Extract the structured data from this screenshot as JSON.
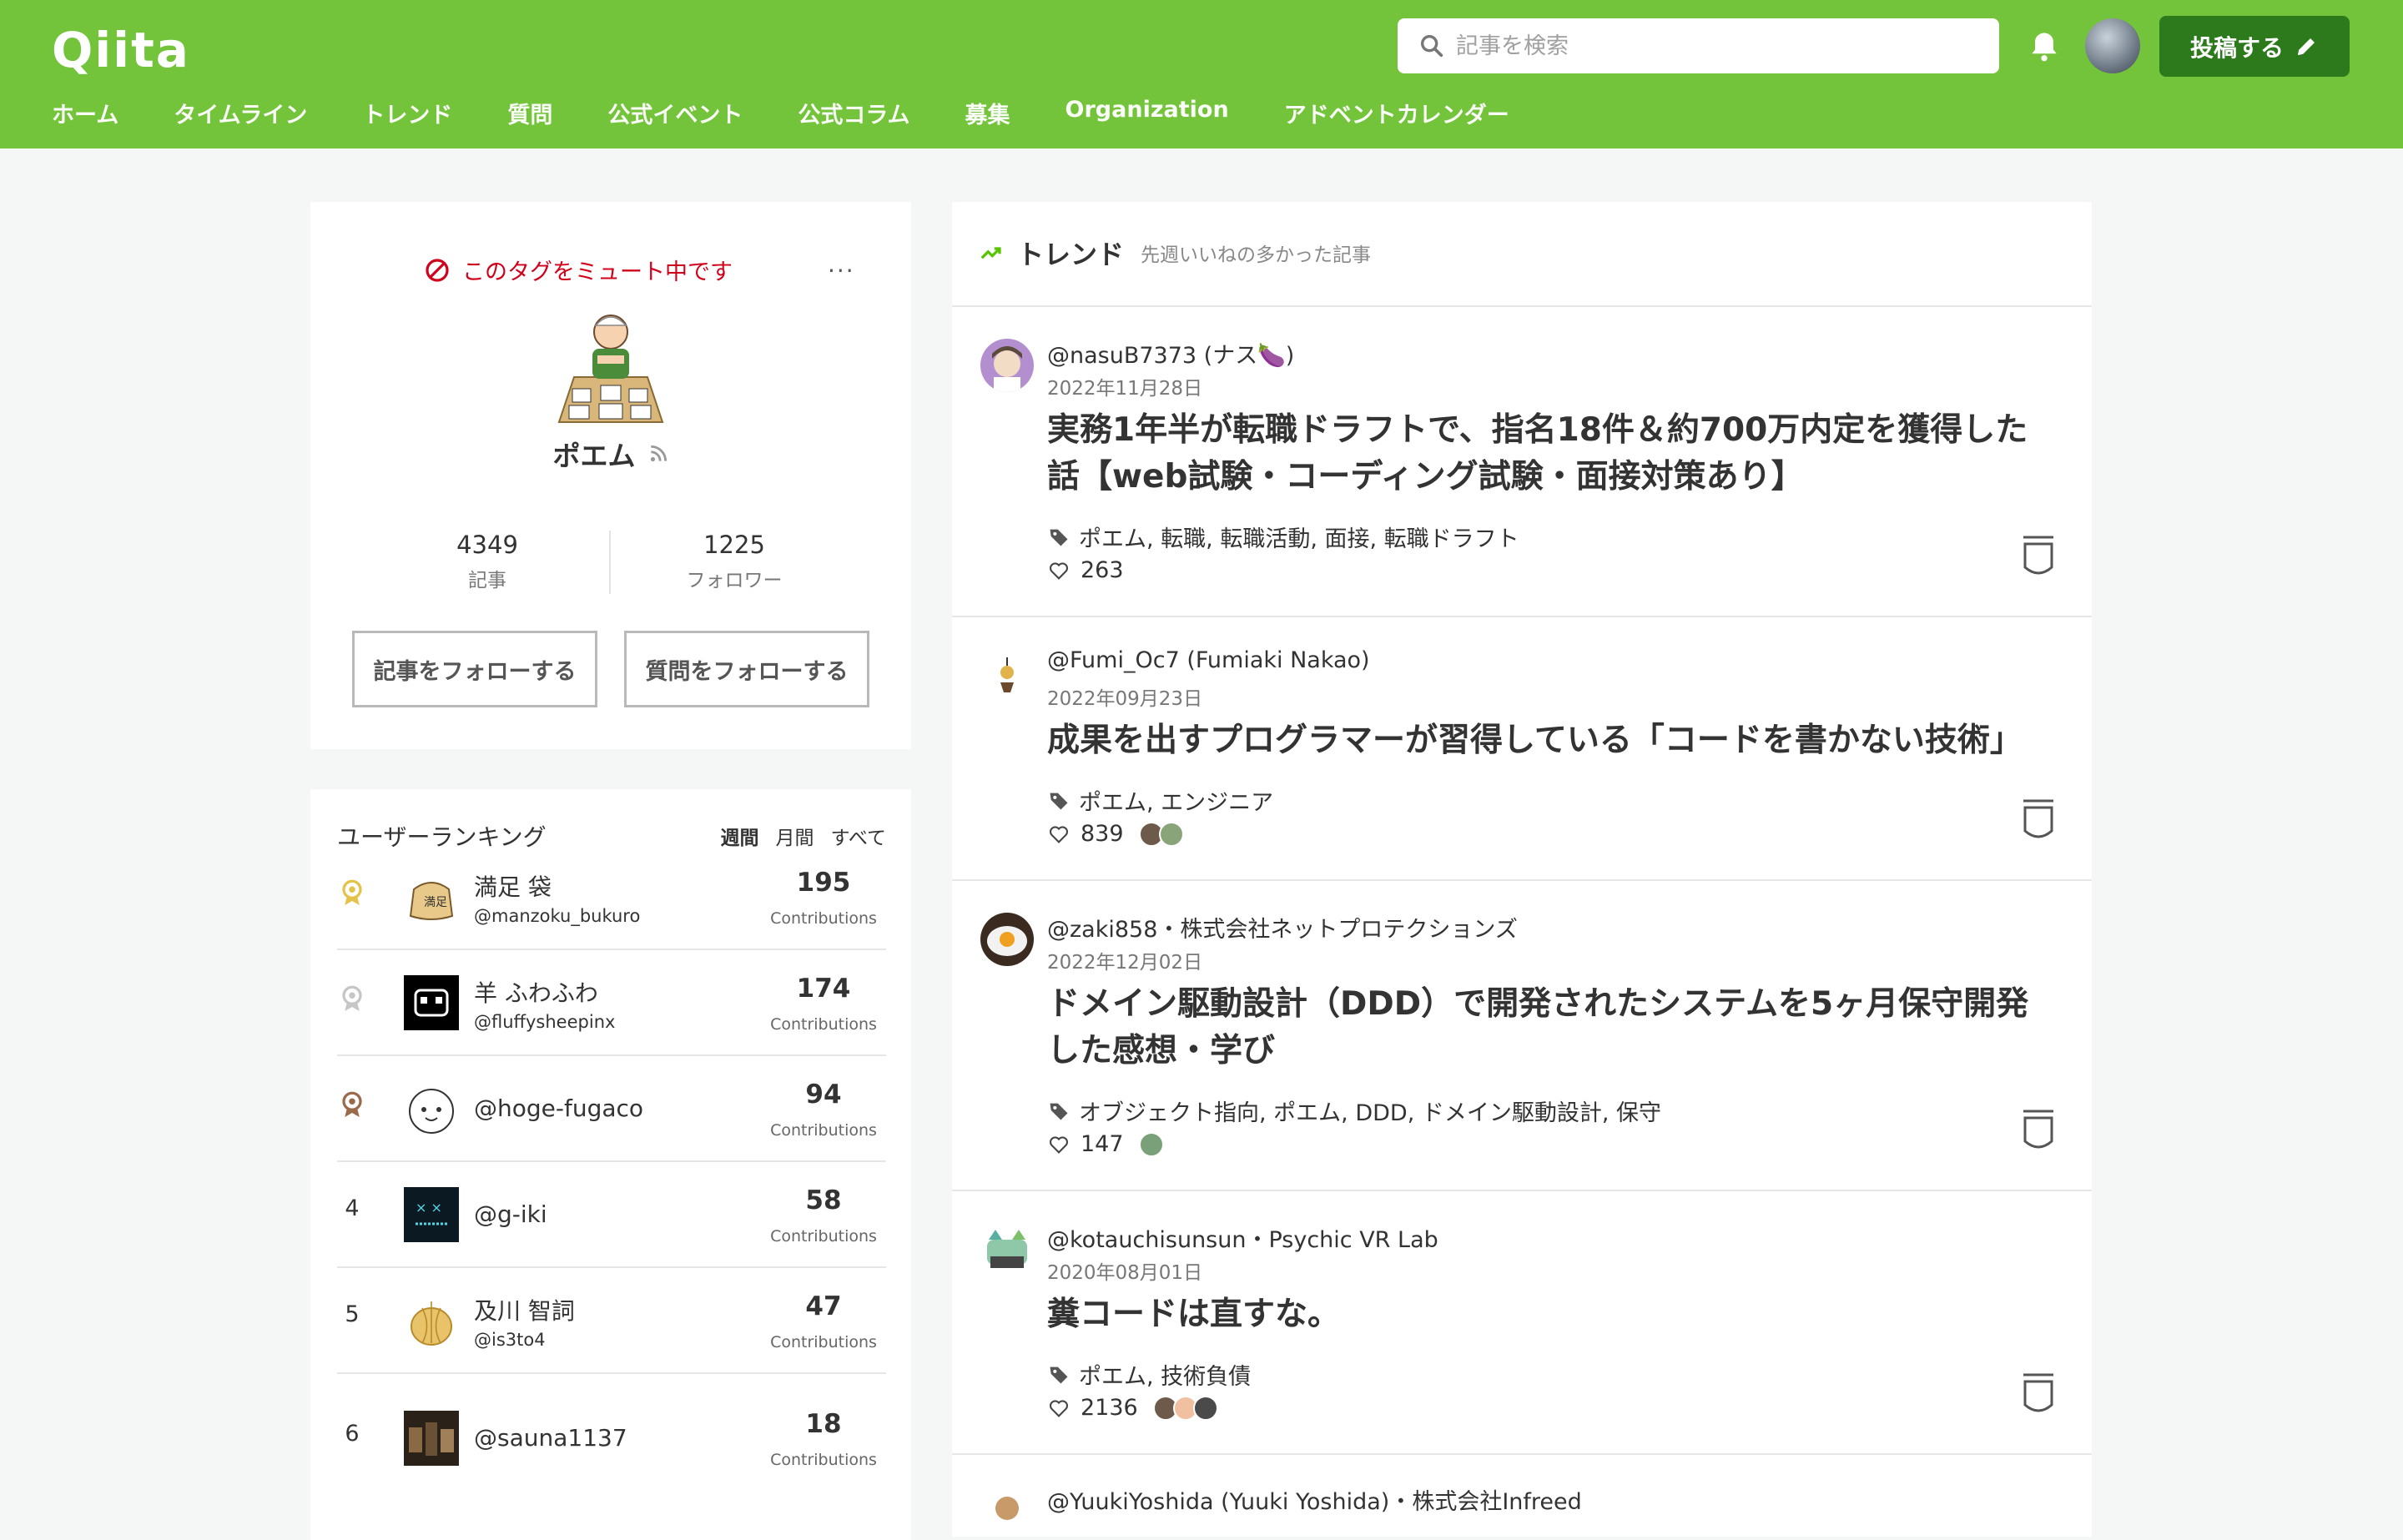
{
  "header": {
    "logo": "Qiita",
    "search_placeholder": "記事を検索",
    "post_button": "投稿する",
    "nav": [
      "ホーム",
      "タイムライン",
      "トレンド",
      "質問",
      "公式イベント",
      "公式コラム",
      "募集",
      "Organization",
      "アドベントカレンダー"
    ]
  },
  "colors": {
    "brand": "#74c43b",
    "brand_dark": "#2d7a1c",
    "mute": "#d0021b"
  },
  "tag": {
    "mute_label": "このタグをミュート中です",
    "more": "···",
    "name": "ポエム",
    "articles_count": "4349",
    "articles_label": "記事",
    "followers_count": "1225",
    "followers_label": "フォロワー",
    "follow_articles": "記事をフォローする",
    "follow_questions": "質問をフォローする"
  },
  "ranking": {
    "title": "ユーザーランキング",
    "tabs": [
      "週間",
      "月間",
      "すべて"
    ],
    "contributions_label": "Contributions",
    "rows": [
      {
        "rank": "1",
        "name": "満足 袋",
        "id": "@manzoku_bukuro",
        "score": "195"
      },
      {
        "rank": "2",
        "name": "羊 ふわふわ",
        "id": "@fluffysheepinx",
        "score": "174"
      },
      {
        "rank": "3",
        "name": "@hoge-fugaco",
        "id": "",
        "score": "94"
      },
      {
        "rank": "4",
        "name": "@g-iki",
        "id": "",
        "score": "58"
      },
      {
        "rank": "5",
        "name": "及川 智詞",
        "id": "@is3to4",
        "score": "47"
      },
      {
        "rank": "6",
        "name": "@sauna1137",
        "id": "",
        "score": "18"
      }
    ]
  },
  "trend": {
    "title": "トレンド",
    "subtitle": "先週いいねの多かった記事",
    "articles": [
      {
        "user": "@nasuB7373 (ナス🍆)",
        "date": "2022年11月28日",
        "title": "実務1年半が転職ドラフトで、指名18件＆約700万内定を獲得した話【web試験・コーディング試験・面接対策あり】",
        "tags": "ポエム, 転職, 転職活動, 面接, 転職ドラフト",
        "likes": "263"
      },
      {
        "user": "@Fumi_Oc7 (Fumiaki Nakao)",
        "date": "2022年09月23日",
        "title": "成果を出すプログラマーが習得している「コードを書かない技術」",
        "tags": "ポエム, エンジニア",
        "likes": "839"
      },
      {
        "user": "@zaki858・株式会社ネットプロテクションズ",
        "date": "2022年12月02日",
        "title": "ドメイン駆動設計（DDD）で開発されたシステムを5ヶ月保守開発した感想・学び",
        "tags": "オブジェクト指向, ポエム, DDD, ドメイン駆動設計, 保守",
        "likes": "147"
      },
      {
        "user": "@kotauchisunsun・Psychic VR Lab",
        "date": "2020年08月01日",
        "title": "糞コードは直すな。",
        "tags": "ポエム, 技術負債",
        "likes": "2136"
      },
      {
        "user": "@YuukiYoshida (Yuuki Yoshida)・株式会社Infreed",
        "date": "",
        "title": "",
        "tags": "",
        "likes": ""
      }
    ]
  }
}
